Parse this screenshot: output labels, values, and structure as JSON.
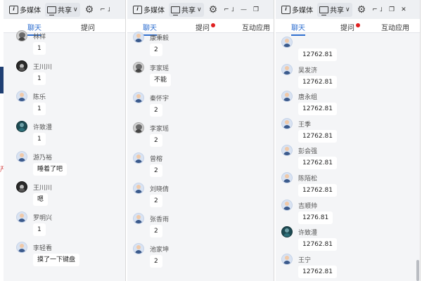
{
  "toolbar": {
    "media_label": "多媒体",
    "share_label": "共享",
    "caret": "∨",
    "gear": "⚙",
    "ctl_min_collapse": "⌐ ˩",
    "ctl_minimize": "—",
    "ctl_restore": "❐",
    "ctl_close": "✕"
  },
  "tabs": {
    "chat": "聊天",
    "question": "提问",
    "interact": "互动应用"
  },
  "edge_char": "严",
  "windows": [
    {
      "messages": [
        {
          "name": "林祥",
          "text": "1",
          "avatar": "gray"
        },
        {
          "name": "王川川",
          "text": "1",
          "avatar": "dark"
        },
        {
          "name": "陈乐",
          "text": "1",
          "avatar": "default"
        },
        {
          "name": "许致澧",
          "text": "1",
          "avatar": "teal"
        },
        {
          "name": "游乃裕",
          "text": "睡着了吧",
          "avatar": "default"
        },
        {
          "name": "王川川",
          "text": "嗯",
          "avatar": "dark"
        },
        {
          "name": "罗明兴",
          "text": "1",
          "avatar": "default"
        },
        {
          "name": "李轻看",
          "text": "摸了一下键盘",
          "avatar": "default"
        }
      ]
    },
    {
      "messages": [
        {
          "name": "康秉毅",
          "text": "2",
          "avatar": "default"
        },
        {
          "name": "李家瑶",
          "text": "不能",
          "avatar": "gray"
        },
        {
          "name": "秦怀宇",
          "text": "2",
          "avatar": "default"
        },
        {
          "name": "李家瑶",
          "text": "2",
          "avatar": "gray"
        },
        {
          "name": "曾榕",
          "text": "2",
          "avatar": "default"
        },
        {
          "name": "刘晓倩",
          "text": "2",
          "avatar": "default"
        },
        {
          "name": "张香雨",
          "text": "2",
          "avatar": "default"
        },
        {
          "name": "池家坤",
          "text": "2",
          "avatar": "default"
        }
      ]
    },
    {
      "messages": [
        {
          "name": "",
          "text": "12762.81",
          "avatar": "default"
        },
        {
          "name": "吴发济",
          "text": "12762.81",
          "avatar": "default"
        },
        {
          "name": "唐永组",
          "text": "12762.81",
          "avatar": "default"
        },
        {
          "name": "王季",
          "text": "12762.81",
          "avatar": "default"
        },
        {
          "name": "彭会强",
          "text": "12762.81",
          "avatar": "default"
        },
        {
          "name": "陈陌松",
          "text": "12762.81",
          "avatar": "default"
        },
        {
          "name": "吉顺帅",
          "text": "1276.81",
          "avatar": "default"
        },
        {
          "name": "许致澧",
          "text": "12762.81",
          "avatar": "teal"
        },
        {
          "name": "王宁",
          "text": "12762.81",
          "avatar": "default"
        }
      ]
    }
  ]
}
